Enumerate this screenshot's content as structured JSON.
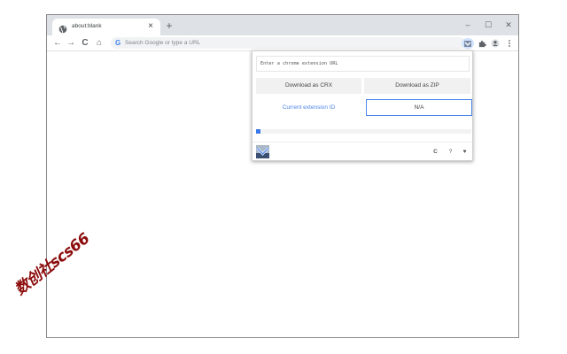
{
  "tab": {
    "title": "about:blank",
    "close": "×",
    "new_tab": "+"
  },
  "window_controls": {
    "minimize": "–",
    "maximize": "☐",
    "close": "✕"
  },
  "toolbar": {
    "back": "←",
    "forward": "→",
    "reload": "C",
    "home": "⌂",
    "omnibox_placeholder": "Search Google or type a URL",
    "google_mark": "G"
  },
  "extension_popup": {
    "url_placeholder": "Enter a chrome extension URL",
    "download_crx": "Download as CRX",
    "download_zip": "Download as ZIP",
    "current_id_label": "Current extension ID",
    "extension_id": "N/A",
    "progress": 0.01,
    "footer": {
      "refresh": "C",
      "help": "?",
      "favorite": "♥"
    }
  },
  "watermark": "数创社scs66",
  "colors": {
    "accent": "#4a86e8",
    "progress": "#3b78e7",
    "tabstrip": "#dee1e6",
    "watermark": "#8b0a0a"
  }
}
